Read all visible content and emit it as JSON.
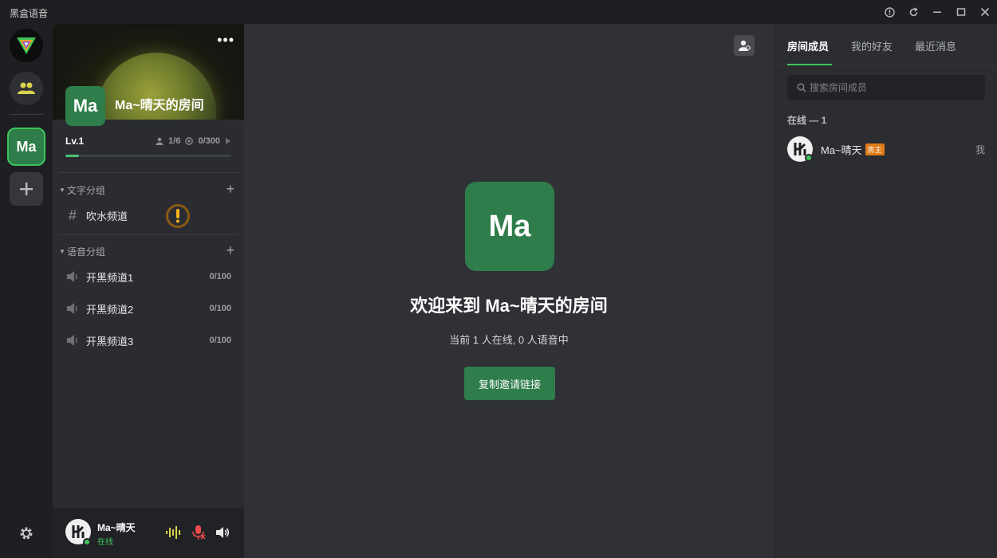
{
  "app": {
    "title": "黑盒语音"
  },
  "rail": {
    "items": [
      "logo",
      "friends",
      "current-room",
      "add-room"
    ],
    "room_initials": "Ma"
  },
  "room": {
    "initials": "Ma",
    "name": "Ma~晴天的房间",
    "level": "Lv.1",
    "members_stat": "1/6",
    "coins_stat": "0/300",
    "level_progress": 0.08
  },
  "groups": {
    "text_group_label": "文字分组",
    "text_channels": [
      {
        "name": "吹水频道"
      }
    ],
    "voice_group_label": "语音分组",
    "voice_channels": [
      {
        "name": "开黑频道1",
        "count": "0/100"
      },
      {
        "name": "开黑频道2",
        "count": "0/100"
      },
      {
        "name": "开黑频道3",
        "count": "0/100"
      }
    ]
  },
  "user": {
    "name": "Ma~晴天",
    "status": "在线"
  },
  "main": {
    "avatar_initials": "Ma",
    "welcome": "欢迎来到 Ma~晴天的房间",
    "online_info": "当前 1 人在线, 0 人语音中",
    "copy_button": "复制邀请链接"
  },
  "right": {
    "tabs": [
      "房间成员",
      "我的好友",
      "最近消息"
    ],
    "search_placeholder": "搜索房间成员",
    "online_header": "在线 — 1",
    "members": [
      {
        "name": "Ma~晴天",
        "badge": "房主",
        "me_label": "我"
      }
    ]
  },
  "colors": {
    "accent": "#2e7d4a",
    "online": "#3ec45b",
    "owner_badge": "#e07b1a"
  }
}
